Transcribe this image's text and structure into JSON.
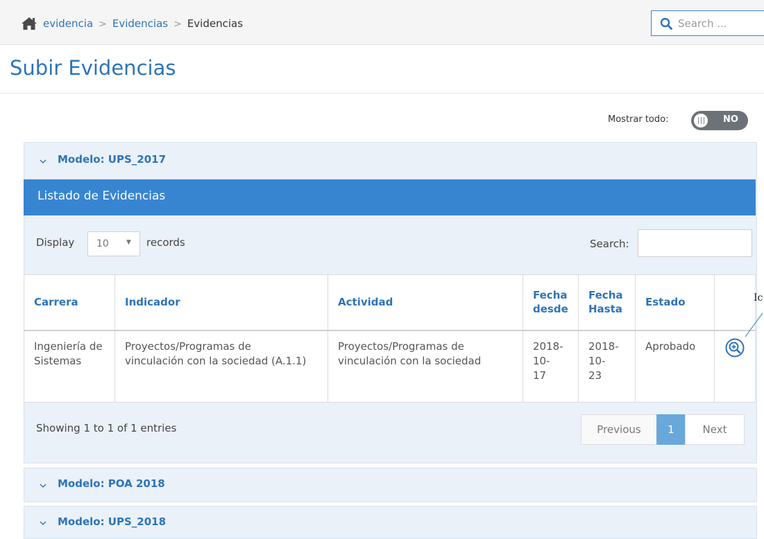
{
  "breadcrumb": {
    "items": [
      "evidencia",
      "Evidencias"
    ],
    "current": "Evidencias",
    "separator": ">"
  },
  "top_search": {
    "placeholder": "Search ..."
  },
  "page": {
    "title": "Subir Evidencias"
  },
  "show_all": {
    "label": "Mostrar todo:",
    "state": "NO"
  },
  "panels": [
    {
      "label": "Modelo: UPS_2017",
      "expanded": true
    },
    {
      "label": "Modelo: POA 2018",
      "expanded": false
    },
    {
      "label": "Modelo: UPS_2018",
      "expanded": false
    }
  ],
  "list": {
    "title": "Listado de Evidencias",
    "display_label": "Display",
    "page_size": "10",
    "records_label": "records",
    "search_label": "Search:",
    "search_value": "",
    "columns": [
      "Carrera",
      "Indicador",
      "Actividad",
      "Fecha desde",
      "Fecha Hasta",
      "Estado",
      ""
    ],
    "rows": [
      {
        "carrera": "Ingeniería de Sistemas",
        "indicador": "Proyectos/Programas de vinculación con la sociedad (A.1.1)",
        "actividad": "Proyectos/Programas de vinculación con la sociedad",
        "fecha_desde": "2018-10-17",
        "fecha_hasta": "2018-10-23",
        "estado": "Aprobado",
        "action_icon": "zoom-in-icon"
      }
    ],
    "showing": "Showing 1 to 1 of 1 entries",
    "pager": {
      "previous": "Previous",
      "current": "1",
      "next": "Next"
    }
  },
  "annotation": {
    "text": "Ic"
  },
  "colors": {
    "accent": "#2d74b9",
    "header_bar": "#3785d1",
    "panel_bg": "#eaf1f9",
    "pager_active": "#69a8da",
    "toggle_bg": "#6d7278"
  }
}
